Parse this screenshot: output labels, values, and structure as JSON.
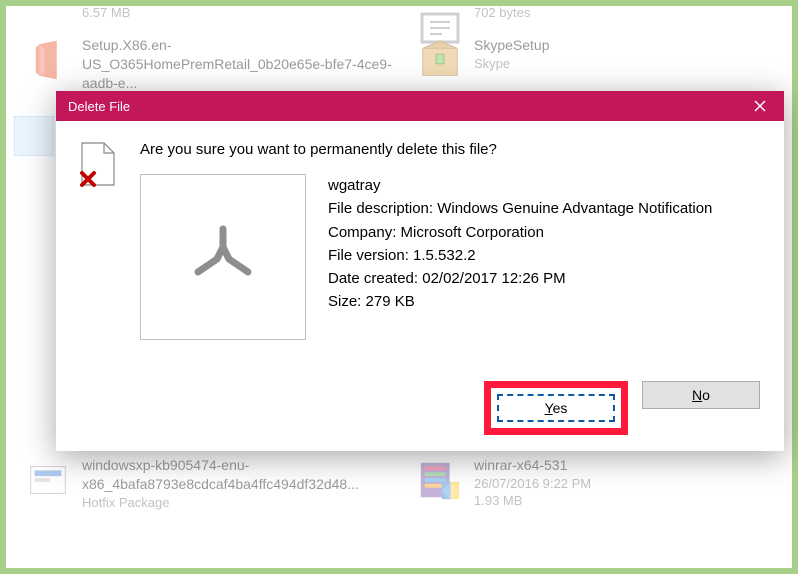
{
  "background": {
    "file_top_size": "6.57 MB",
    "file_top_size_right": "702 bytes",
    "office": {
      "name": "Setup.X86.en-US_O365HomePremRetail_0b20e65e-bfe7-4ce9-aadb-e..."
    },
    "skype": {
      "name": "SkypeSetup",
      "sub": "Skype"
    },
    "hotfix": {
      "name": "windowsxp-kb905474-enu-x86_4bafa8793e8cdcaf4ba4ffc494df32d48...",
      "sub": "Hotfix Package"
    },
    "winrar": {
      "name": "winrar-x64-531",
      "date": "26/07/2016 9:22 PM",
      "size": "1.93 MB"
    }
  },
  "dialog": {
    "title": "Delete File",
    "prompt": "Are you sure you want to permanently delete this file?",
    "details": {
      "name": "wgatray",
      "desc_label": "File description:",
      "desc": "Windows Genuine Advantage Notification",
      "company_label": "Company:",
      "company": "Microsoft Corporation",
      "version_label": "File version:",
      "version": "1.5.532.2",
      "date_label": "Date created:",
      "date": "02/02/2017 12:26 PM",
      "size_label": "Size:",
      "size": "279 KB"
    },
    "yes": "Yes",
    "no": "No"
  }
}
